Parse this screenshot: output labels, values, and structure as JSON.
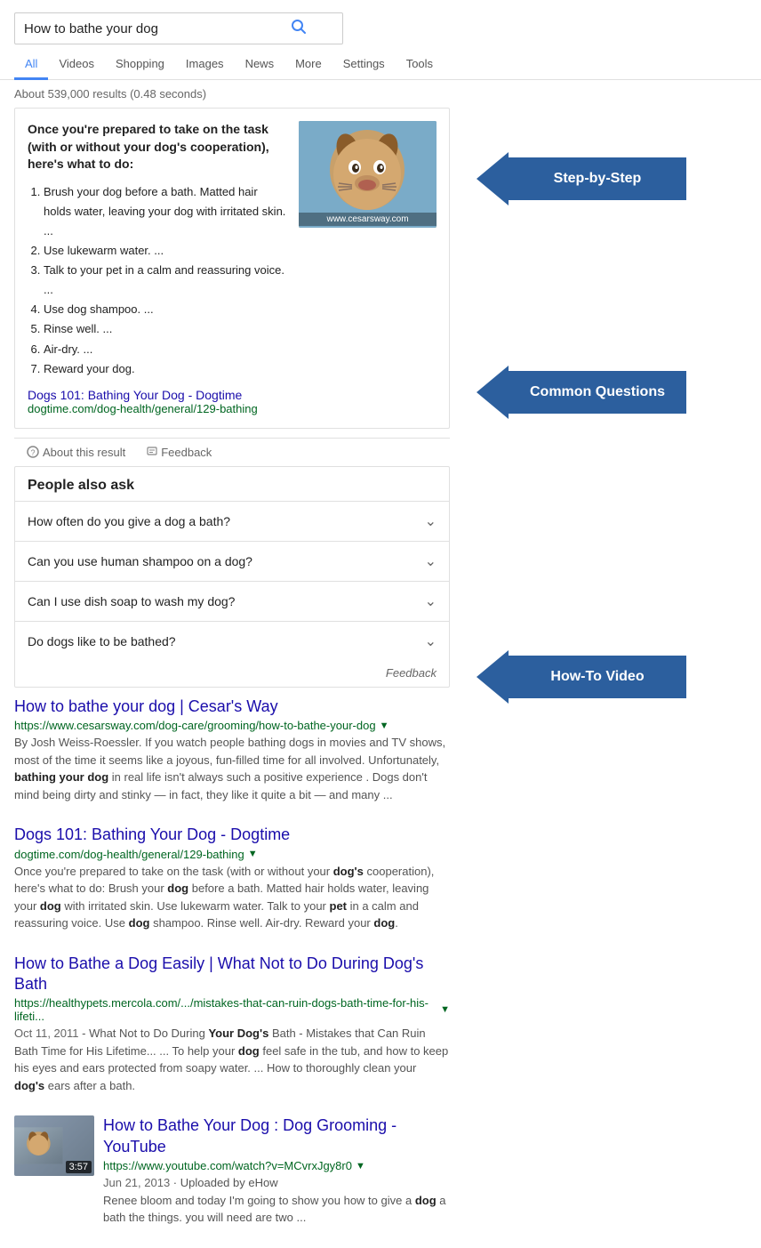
{
  "search": {
    "query": "How to bathe your dog",
    "placeholder": "How to bathe your dog",
    "result_count": "About 539,000 results (0.48 seconds)"
  },
  "nav": {
    "tabs": [
      {
        "label": "All",
        "active": true
      },
      {
        "label": "Videos",
        "active": false
      },
      {
        "label": "Shopping",
        "active": false
      },
      {
        "label": "Images",
        "active": false
      },
      {
        "label": "News",
        "active": false
      },
      {
        "label": "More",
        "active": false
      },
      {
        "label": "Settings",
        "active": false
      },
      {
        "label": "Tools",
        "active": false
      }
    ]
  },
  "featured_snippet": {
    "title": "Once you're prepared to take on the task (with or without your dog's cooperation), here's what to do:",
    "steps": [
      "Brush your dog before a bath. Matted hair holds water, leaving your dog with irritated skin. ...",
      "Use lukewarm water. ...",
      "Talk to your pet in a calm and reassuring voice. ...",
      "Use dog shampoo. ...",
      "Rinse well. ...",
      "Air-dry. ...",
      "Reward your dog."
    ],
    "image_label": "www.cesarsway.com",
    "link_title": "Dogs 101: Bathing Your Dog - Dogtime",
    "link_url": "dogtime.com/dog-health/general/129-bathing"
  },
  "meta_bar": {
    "about": "About this result",
    "feedback": "Feedback"
  },
  "paa": {
    "title": "People also ask",
    "questions": [
      "How often do you give a dog a bath?",
      "Can you use human shampoo on a dog?",
      "Can I use dish soap to wash my dog?",
      "Do dogs like to be bathed?"
    ],
    "feedback_label": "Feedback"
  },
  "results": [
    {
      "title": "How to bathe your dog | Cesar's Way",
      "url": "https://www.cesarsway.com/dog-care/grooming/how-to-bathe-your-dog",
      "snippet": "By Josh Weiss-Roessler. If you watch people bathing dogs in movies and TV shows, most of the time it seems like a joyous, fun-filled time for all involved. Unfortunately, bathing your dog in real life isn't always such a positive experience . Dogs don't mind being dirty and stinky — in fact, they like it quite a bit — and many ..."
    },
    {
      "title": "Dogs 101: Bathing Your Dog - Dogtime",
      "url": "dogtime.com/dog-health/general/129-bathing",
      "snippet": "Once you're prepared to take on the task (with or without your dog's cooperation), here's what to do: Brush your dog before a bath. Matted hair holds water, leaving your dog with irritated skin. Use lukewarm water. Talk to your pet in a calm and reassuring voice. Use dog shampoo. Rinse well. Air-dry. Reward your dog."
    },
    {
      "title": "How to Bathe a Dog Easily | What Not to Do During Dog's Bath",
      "url": "https://healthypets.mercola.com/.../mistakes-that-can-ruin-dogs-bath-time-for-his-lifeti...",
      "date": "Oct 11, 2011",
      "snippet": "What Not to Do During Your Dog's Bath - Mistakes that Can Ruin Bath Time for His Lifetime... ... To help your dog feel safe in the tub, and how to keep his eyes and ears protected from soapy water. ... How to thoroughly clean your dog's ears after a bath."
    },
    {
      "title": "How to Bathe Your Dog : Dog Grooming - YouTube",
      "url": "https://www.youtube.com/watch?v=MCvrxJgy8r0",
      "date": "Jun 21, 2013",
      "uploaded_by": "Uploaded by eHow",
      "duration": "3:57",
      "snippet": "Renee bloom and today I'm going to show you how to give a dog a bath the things. you will need are two ..."
    }
  ],
  "annotations": {
    "step_by_step": "Step-by-Step",
    "common_questions": "Common Questions",
    "how_to_video": "How-To Video"
  }
}
